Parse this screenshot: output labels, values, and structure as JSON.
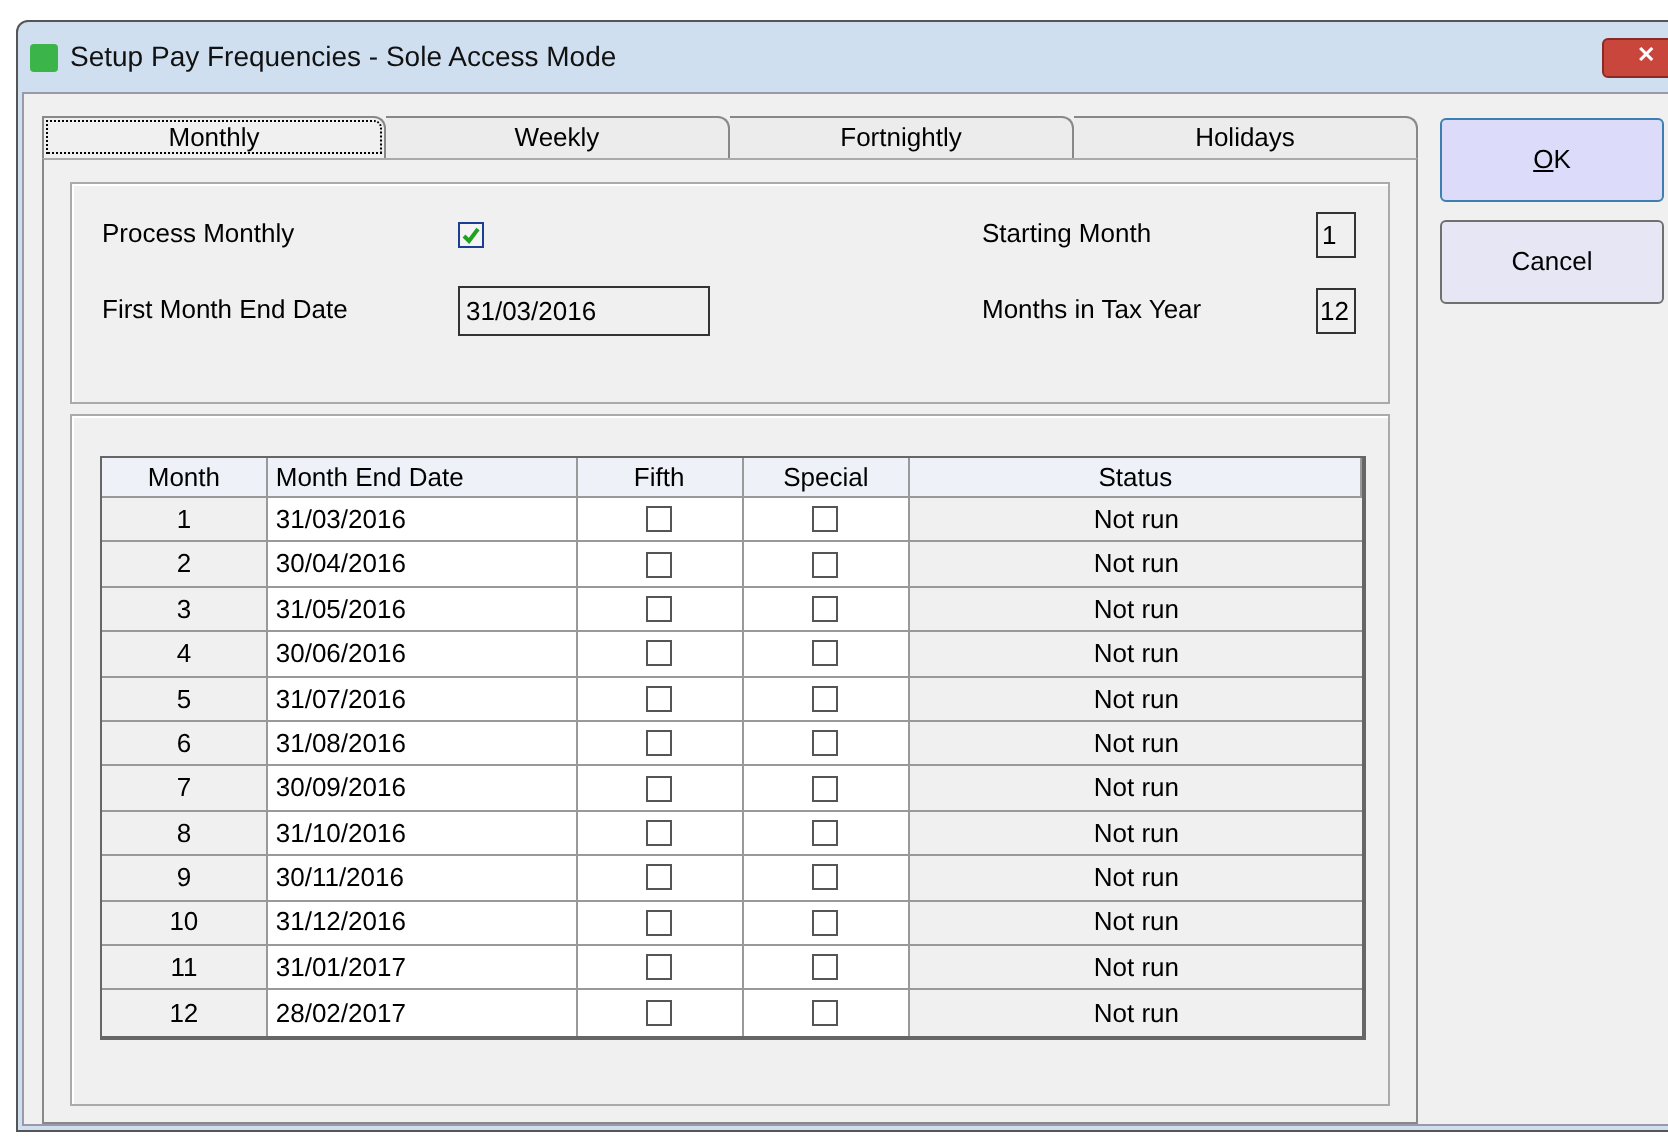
{
  "window": {
    "title": "Setup Pay Frequencies - Sole Access Mode",
    "close": "✕"
  },
  "tabs": [
    {
      "label": "Monthly",
      "selected": true
    },
    {
      "label": "Weekly",
      "selected": false
    },
    {
      "label": "Fortnightly",
      "selected": false
    },
    {
      "label": "Holidays",
      "selected": false
    }
  ],
  "settings": {
    "process_monthly": {
      "label": "Process Monthly",
      "checked": true
    },
    "first_month_end_date": {
      "label": "First Month End Date",
      "value": "31/03/2016"
    },
    "starting_month": {
      "label": "Starting Month",
      "value": "1"
    },
    "months_in_tax_year": {
      "label": "Months in Tax Year",
      "value": "12"
    }
  },
  "table": {
    "columns": [
      "Month",
      "Month End Date",
      "Fifth",
      "Special",
      "Status"
    ],
    "rows": [
      {
        "month": "1",
        "date": "31/03/2016",
        "fifth": false,
        "special": false,
        "status": "Not run"
      },
      {
        "month": "2",
        "date": "30/04/2016",
        "fifth": false,
        "special": false,
        "status": "Not run"
      },
      {
        "month": "3",
        "date": "31/05/2016",
        "fifth": false,
        "special": false,
        "status": "Not run"
      },
      {
        "month": "4",
        "date": "30/06/2016",
        "fifth": false,
        "special": false,
        "status": "Not run"
      },
      {
        "month": "5",
        "date": "31/07/2016",
        "fifth": false,
        "special": false,
        "status": "Not run"
      },
      {
        "month": "6",
        "date": "31/08/2016",
        "fifth": false,
        "special": false,
        "status": "Not run"
      },
      {
        "month": "7",
        "date": "30/09/2016",
        "fifth": false,
        "special": false,
        "status": "Not run"
      },
      {
        "month": "8",
        "date": "31/10/2016",
        "fifth": false,
        "special": false,
        "status": "Not run"
      },
      {
        "month": "9",
        "date": "30/11/2016",
        "fifth": false,
        "special": false,
        "status": "Not run"
      },
      {
        "month": "10",
        "date": "31/12/2016",
        "fifth": false,
        "special": false,
        "status": "Not run"
      },
      {
        "month": "11",
        "date": "31/01/2017",
        "fifth": false,
        "special": false,
        "status": "Not run"
      },
      {
        "month": "12",
        "date": "28/02/2017",
        "fifth": false,
        "special": false,
        "status": "Not run"
      }
    ]
  },
  "buttons": [
    {
      "label": "OK",
      "mnemonic": true
    },
    {
      "label": "Cancel",
      "mnemonic": false
    }
  ]
}
